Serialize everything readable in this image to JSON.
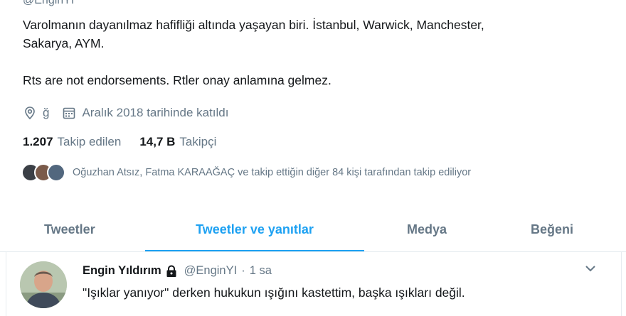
{
  "profile": {
    "handle_top": "@EnginYI",
    "bio_line1": "Varolmanın dayanılmaz hafifliği altında yaşayan biri. İstanbul, Warwick, Manchester,",
    "bio_line2": "Sakarya, AYM.",
    "bio_line3": "Rts are not endorsements. Rtler onay anlamına gelmez.",
    "location": "ğ",
    "joined": "Aralık 2018 tarihinde katıldı",
    "following_count": "1.207",
    "following_label": "Takip edilen",
    "followers_count": "14,7 B",
    "followers_label": "Takipçi",
    "followed_by_text": "Oğuzhan Atsız, Fatma KARAAĞAÇ ve takip ettiğin diğer 84 kişi tarafından takip ediliyor"
  },
  "tabs": [
    {
      "label": "Tweetler"
    },
    {
      "label": "Tweetler ve yanıtlar"
    },
    {
      "label": "Medya"
    },
    {
      "label": "Beğeni"
    }
  ],
  "active_tab": "Tweetler ve yanıtlar",
  "tweet": {
    "name": "Engin Yıldırım",
    "handle": "@EnginYI",
    "dot": "·",
    "time": "1 sa",
    "text": "\"Işıklar yanıyor\" derken hukukun ışığını kastettim, başka ışıkları değil."
  },
  "colors": {
    "accent": "#1da1f2",
    "secondary_text": "#657786",
    "divider": "#e6ecf0"
  },
  "icons": [
    "location-icon",
    "calendar-icon",
    "lock-icon",
    "chevron-down-icon"
  ]
}
